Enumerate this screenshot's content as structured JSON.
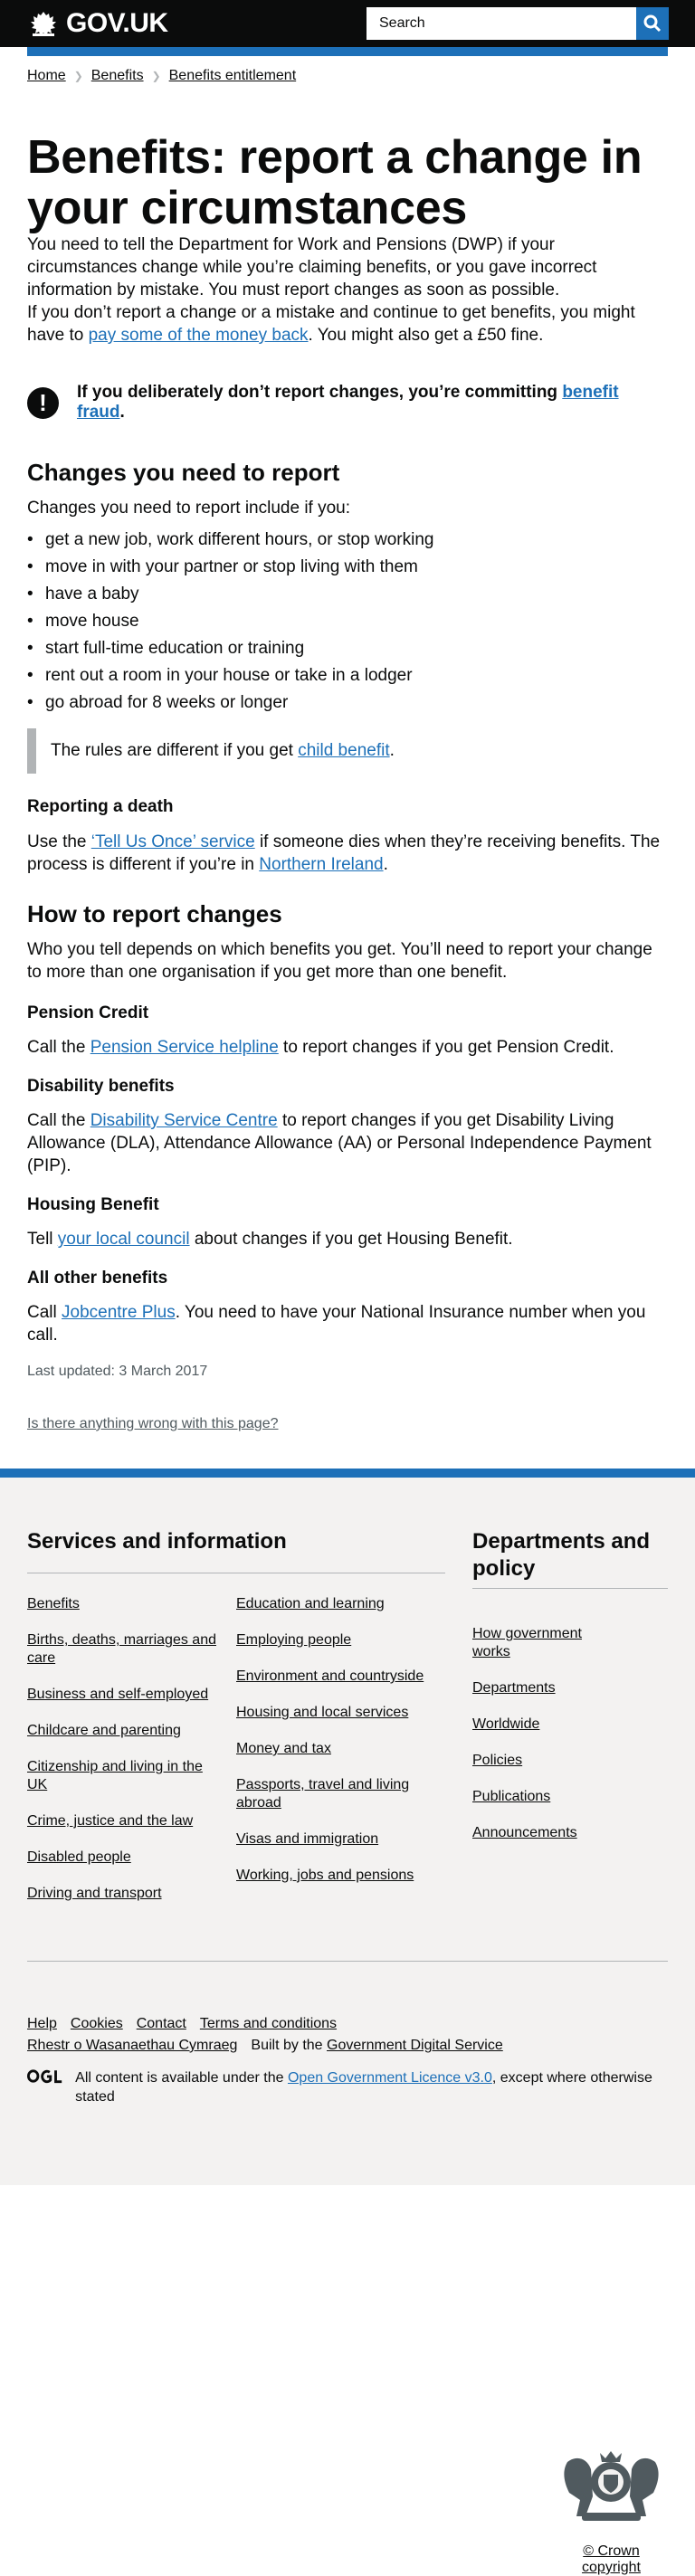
{
  "header": {
    "logo_text": "GOV.UK",
    "search_placeholder": "Search"
  },
  "breadcrumbs": [
    "Home",
    "Benefits",
    "Benefits entitlement"
  ],
  "title": "Benefits: report a change in your circumstances",
  "intro": {
    "p1": "You need to tell the Department for Work and Pensions (DWP) if your circumstances change while you’re claiming benefits, or you gave incorrect information by mistake. You must report changes as soon as possible.",
    "p2_before": "If you don’t report a change or a mistake and continue to get benefits, you might have to ",
    "p2_link": "pay some of the money back",
    "p2_after": ". You might also get a £50 fine."
  },
  "warning": {
    "icon": "!",
    "text_before": "If you deliberately don’t report changes, you’re committing ",
    "link": "benefit fraud",
    "text_after": "."
  },
  "changes": {
    "heading": "Changes you need to report",
    "lead": "Changes you need to report include if you:",
    "items": [
      "get a new job, work different hours, or stop working",
      "move in with your partner or stop living with them",
      "have a baby",
      "move house",
      "start full-time education or training",
      "rent out a room in your house or take in a lodger",
      "go abroad for 8 weeks or longer"
    ],
    "inset_before": "The rules are different if you get ",
    "inset_link": "child benefit",
    "inset_after": "."
  },
  "death": {
    "heading": "Reporting a death",
    "before": "Use the ",
    "link1": "‘Tell Us Once’ service",
    "middle": " if someone dies when they’re receiving benefits. The process is different if you’re in ",
    "link2": "Northern Ireland",
    "after": "."
  },
  "how": {
    "heading": "How to report changes",
    "lead": "Who you tell depends on which benefits you get. You’ll need to report your change to more than one organisation if you get more than one benefit.",
    "pension_heading": "Pension Credit",
    "pension_before": "Call the ",
    "pension_link": "Pension Service helpline",
    "pension_after": " to report changes if you get Pension Credit.",
    "disability_heading": "Disability benefits",
    "disability_before": "Call the ",
    "disability_link": "Disability Service Centre",
    "disability_after": " to report changes if you get Disability Living Allowance (DLA), Attendance Allowance (AA) or Personal Independence Payment (PIP).",
    "housing_heading": "Housing Benefit",
    "housing_before": "Tell ",
    "housing_link": "your local council",
    "housing_after": " about changes if you get Housing Benefit.",
    "other_heading": "All other benefits",
    "other_before": "Call ",
    "other_link": "Jobcentre Plus",
    "other_after": ". You need to have your National Insurance number when you call."
  },
  "updated": "Last updated: 3 March 2017",
  "report_link": "Is there anything wrong with this page?",
  "footer": {
    "services_heading": "Services and information",
    "services_col1": [
      "Benefits",
      "Births, deaths, marriages and care",
      "Business and self-employed",
      "Childcare and parenting",
      "Citizenship and living in the UK",
      "Crime, justice and the law",
      "Disabled people",
      "Driving and transport"
    ],
    "services_col2": [
      "Education and learning",
      "Employing people",
      "Environment and countryside",
      "Housing and local services",
      "Money and tax",
      "Passports, travel and living abroad",
      "Visas and immigration",
      "Working, jobs and pensions"
    ],
    "depts_heading": "Departments and policy",
    "depts_links": [
      "How government works",
      "Departments",
      "Worldwide",
      "Policies",
      "Publications",
      "Announcements"
    ],
    "meta_links": [
      "Help",
      "Cookies",
      "Contact",
      "Terms and conditions"
    ],
    "welsh": "Rhestr o Wasanaethau Cymraeg",
    "built_before": "Built by the ",
    "built_link": "Government Digital Service",
    "licence_before": "All content is available under the ",
    "licence_link": "Open Government Licence v3.0",
    "licence_after": ", except where otherwise stated",
    "ogl_icon": "ogl-logo",
    "copyright": "© Crown copyright"
  },
  "colors": {
    "header_bg": "#0b0c0c",
    "brand_blue": "#1d70b8",
    "footer_bg": "#f3f2f1",
    "inset_border": "#b1b4b6"
  }
}
